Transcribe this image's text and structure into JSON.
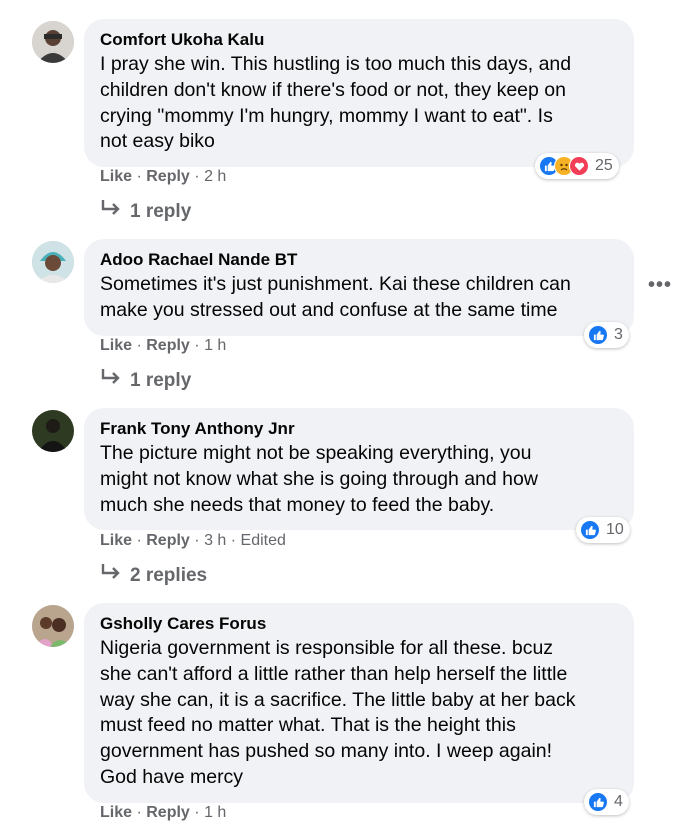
{
  "comments": [
    {
      "author": "Comfort Ukoha Kalu",
      "lines": [
        "I pray she win. This hustling is too much this days, and",
        "children don't know if there's food or not, they keep on",
        "crying \"mommy I'm hungry, mommy I want to eat\". Is",
        "not easy biko"
      ],
      "like": "Like",
      "reply": "Reply",
      "time": "2 h",
      "edited": "",
      "reaction_count": "25",
      "reaction_types": [
        "like-icon",
        "sad-icon",
        "love-icon"
      ],
      "replies_label": "1 reply"
    },
    {
      "author": "Adoo Rachael Nande BT",
      "lines": [
        "Sometimes it's just punishment. Kai these children can",
        "make you stressed out and confuse at the same time"
      ],
      "like": "Like",
      "reply": "Reply",
      "time": "1 h",
      "edited": "",
      "reaction_count": "3",
      "reaction_types": [
        "like-icon"
      ],
      "replies_label": "1 reply",
      "more_label": "•••"
    },
    {
      "author": "Frank Tony Anthony Jnr",
      "lines": [
        "The picture might not be speaking everything, you",
        "might not know what she is going through and how",
        "much she needs that money to feed the baby."
      ],
      "like": "Like",
      "reply": "Reply",
      "time": "3 h",
      "edited": "Edited",
      "reaction_count": "10",
      "reaction_types": [
        "like-icon"
      ],
      "replies_label": "2 replies"
    },
    {
      "author": "Gsholly Cares Forus",
      "lines": [
        "Nigeria government is responsible for all these. bcuz",
        "she can't afford a little rather than help herself the little",
        "way she can, it is a sacrifice. The little baby at her back",
        "must feed no matter what. That is the height this",
        "government has pushed so many into. I weep again!",
        "God have mercy"
      ],
      "like": "Like",
      "reply": "Reply",
      "time": "1 h",
      "edited": "",
      "reaction_count": "4",
      "reaction_types": [
        "like-icon"
      ]
    }
  ],
  "colors": {
    "bubble": "#f0f2f5",
    "meta": "#65676b",
    "like_blue": "#1877f2"
  }
}
